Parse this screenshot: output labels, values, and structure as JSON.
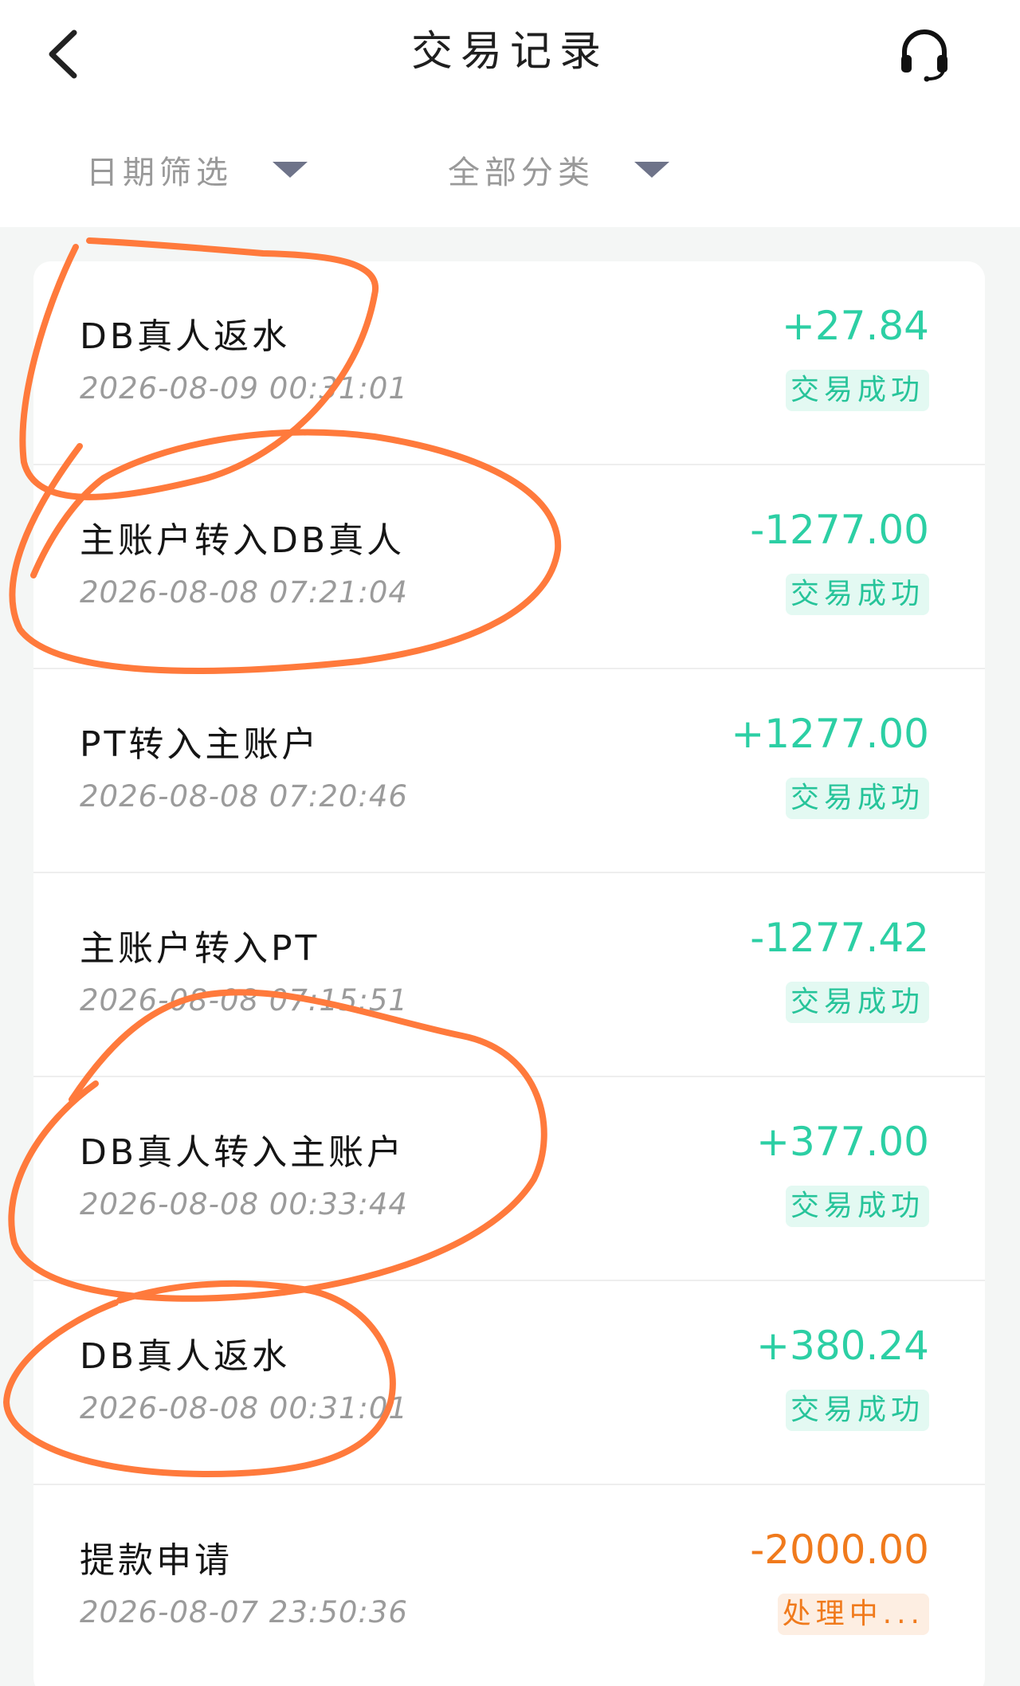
{
  "header": {
    "title": "交易记录",
    "back_icon": "chevron-left-icon",
    "support_icon": "headset-icon"
  },
  "filters": {
    "date_label": "日期筛选",
    "category_label": "全部分类"
  },
  "colors": {
    "positive": "#2ccfa4",
    "pending": "#f07a1c",
    "annotation": "#ff7a3c"
  },
  "transactions": [
    {
      "name": "DB真人返水",
      "time": "2026-08-09 00:31:01",
      "amount": "+27.84",
      "status": "交易成功"
    },
    {
      "name": "主账户转入DB真人",
      "time": "2026-08-08 07:21:04",
      "amount": "-1277.00",
      "status": "交易成功"
    },
    {
      "name": "PT转入主账户",
      "time": "2026-08-08 07:20:46",
      "amount": "+1277.00",
      "status": "交易成功"
    },
    {
      "name": "主账户转入PT",
      "time": "2026-08-08 07:15:51",
      "amount": "-1277.42",
      "status": "交易成功"
    },
    {
      "name": "DB真人转入主账户",
      "time": "2026-08-08 00:33:44",
      "amount": "+377.00",
      "status": "交易成功"
    },
    {
      "name": "DB真人返水",
      "time": "2026-08-08 00:31:01",
      "amount": "+380.24",
      "status": "交易成功"
    },
    {
      "name": "提款申请",
      "time": "2026-08-07 23:50:36",
      "amount": "-2000.00",
      "status": "处理中..."
    }
  ]
}
